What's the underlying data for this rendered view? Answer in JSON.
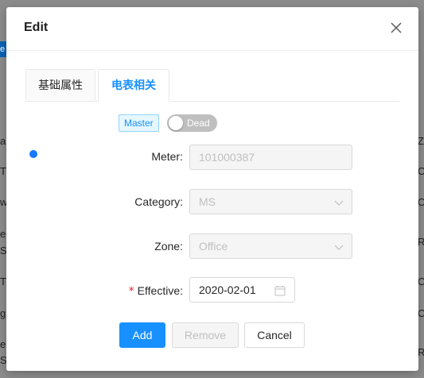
{
  "background": {
    "tag_text": "e",
    "left_fragments": [
      "a",
      "T",
      "w",
      "e",
      "S",
      "T",
      "g",
      "e",
      "S"
    ],
    "right_fragments": [
      "Z",
      "O",
      "O",
      "R",
      "O",
      "O",
      "R"
    ]
  },
  "modal": {
    "title": "Edit",
    "tabs": [
      {
        "label": "基础属性",
        "active": false
      },
      {
        "label": "电表相关",
        "active": true
      }
    ],
    "master_tag": "Master",
    "dead_switch": {
      "label": "Dead",
      "checked": false
    },
    "fields": {
      "meter": {
        "label": "Meter",
        "value": "101000387"
      },
      "category": {
        "label": "Category",
        "value": "MS"
      },
      "zone": {
        "label": "Zone",
        "value": "Office"
      },
      "effective": {
        "label": "Effective",
        "value": "2020-02-01",
        "required": true
      }
    },
    "buttons": {
      "add": "Add",
      "remove": "Remove",
      "cancel": "Cancel"
    },
    "colors": {
      "primary": "#1890ff",
      "required": "#f5222d",
      "bullet": "#1677ff"
    }
  }
}
